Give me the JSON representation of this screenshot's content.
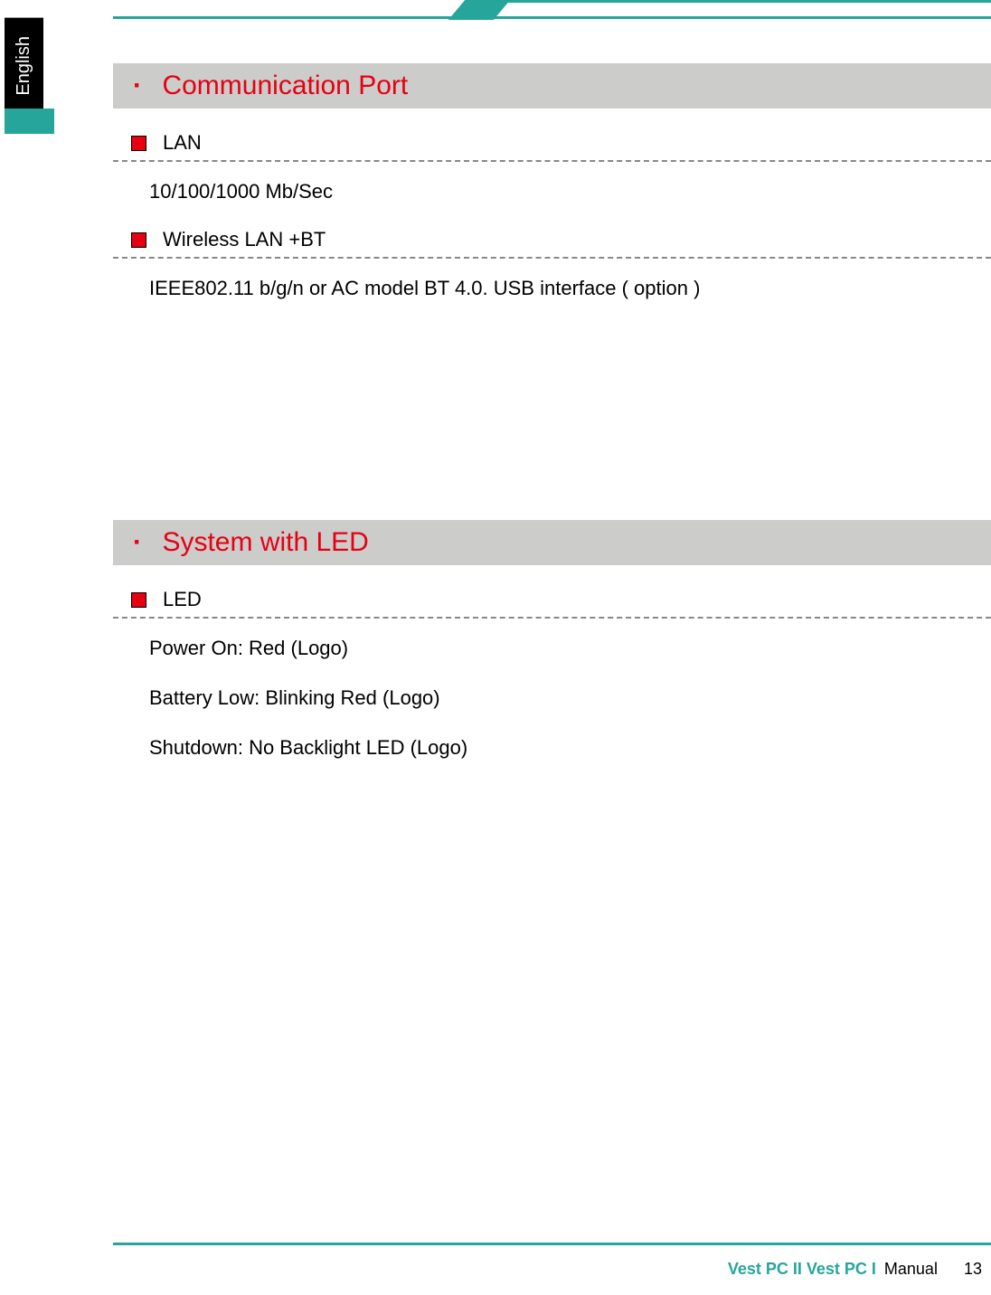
{
  "language_tab": "English",
  "sections": [
    {
      "title": "Communication Port",
      "items": [
        {
          "heading": "LAN",
          "lines": [
            "10/100/1000 Mb/Sec"
          ]
        },
        {
          "heading": "Wireless LAN +BT",
          "lines": [
            "IEEE802.11 b/g/n or AC model BT 4.0. USB interface ( option )"
          ]
        }
      ]
    },
    {
      "title": "System with LED",
      "items": [
        {
          "heading": "LED",
          "lines": [
            "Power On: Red  (Logo)",
            "Battery Low: Blinking Red  (Logo)",
            "Shutdown: No Backlight LED (Logo)"
          ]
        }
      ]
    }
  ],
  "footer": {
    "brand": "Vest PC II Vest PC I",
    "label": "Manual",
    "page": "13"
  }
}
